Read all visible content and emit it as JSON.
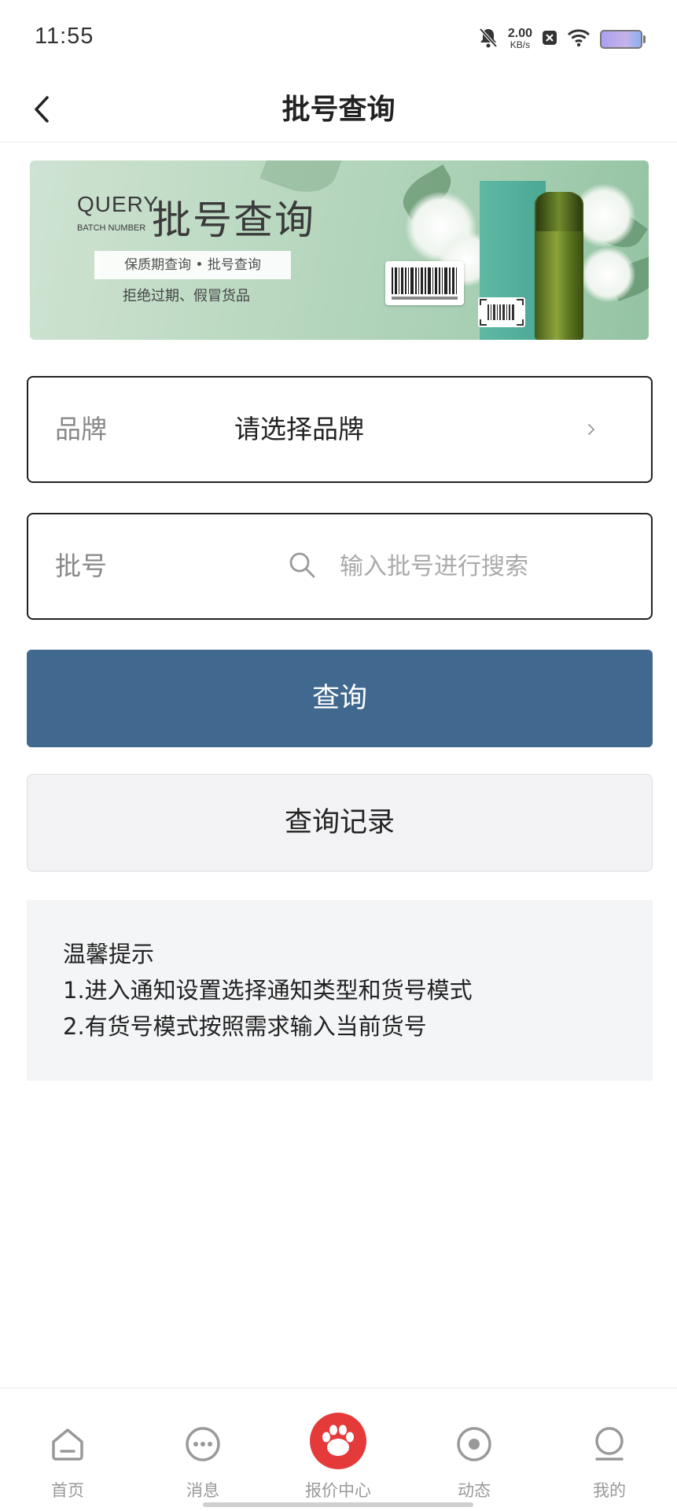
{
  "status_bar": {
    "time": "11:55",
    "net_speed_value": "2.00",
    "net_speed_unit": "KB/s",
    "icons": [
      "bell-off-icon",
      "close-box-icon",
      "wifi-icon",
      "battery-icon"
    ]
  },
  "header": {
    "title": "批号查询",
    "back_icon": "chevron-left-icon"
  },
  "banner": {
    "query_en": "QUERY",
    "batch_en": "BATCH NUMBER",
    "title": "批号查询",
    "tag": "保质期查询 • 批号查询",
    "slogan": "拒绝过期、假冒货品"
  },
  "brand_field": {
    "label": "品牌",
    "value": "请选择品牌"
  },
  "batch_field": {
    "label": "批号",
    "placeholder": "输入批号进行搜索",
    "value": ""
  },
  "actions": {
    "query_label": "查询",
    "history_label": "查询记录"
  },
  "tips": {
    "title": "温馨提示",
    "line1": "1.进入通知设置选择通知类型和货号模式",
    "line2": "2.有货号模式按照需求输入当前货号"
  },
  "bottom_nav": {
    "items": [
      {
        "label": "首页",
        "icon": "home-icon"
      },
      {
        "label": "消息",
        "icon": "message-icon"
      },
      {
        "label": "报价中心",
        "icon": "paw-icon"
      },
      {
        "label": "动态",
        "icon": "activity-icon"
      },
      {
        "label": "我的",
        "icon": "profile-icon"
      }
    ]
  },
  "colors": {
    "primary": "#41688e",
    "accent_red": "#e53a3a",
    "nav_text": "#999999"
  }
}
